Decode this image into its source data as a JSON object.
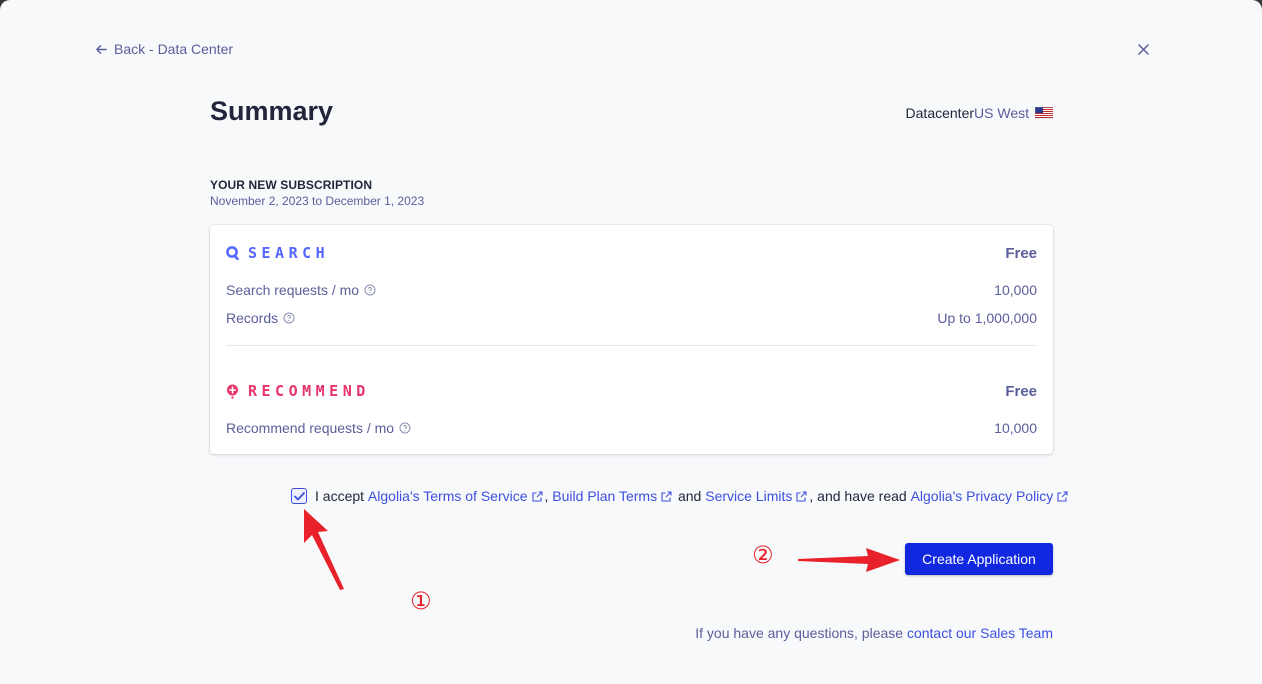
{
  "nav": {
    "back_label": "Back - Data Center"
  },
  "summary": {
    "title": "Summary",
    "datacenter_label": "Datacenter",
    "datacenter_region": "US West",
    "subscription_heading": "YOUR NEW SUBSCRIPTION",
    "subscription_dates": "November 2, 2023 to December 1, 2023"
  },
  "plan": {
    "search": {
      "name": "SEARCH",
      "price": "Free",
      "rows": [
        {
          "label": "Search requests / mo",
          "value": "10,000"
        },
        {
          "label": "Records",
          "value": "Up to 1,000,000"
        }
      ]
    },
    "recommend": {
      "name": "RECOMMEND",
      "price": "Free",
      "rows": [
        {
          "label": "Recommend requests / mo",
          "value": "10,000"
        }
      ]
    }
  },
  "terms": {
    "checked": true,
    "prefix": "I accept ",
    "tos_link": "Algolia's Terms of Service",
    "sep1": ", ",
    "build_link": "Build Plan Terms",
    "and": " and ",
    "limits_link": "Service Limits",
    "have_read": ", and have read ",
    "privacy_link": "Algolia's Privacy Policy"
  },
  "actions": {
    "create_label": "Create Application"
  },
  "footer": {
    "text": "If you have any questions, please ",
    "link": "contact our Sales Team"
  },
  "annotations": {
    "marker_1": "①",
    "marker_2": "②",
    "color": "#e8212a"
  },
  "colors": {
    "primary": "#1128e0",
    "search_brand": "#5468ff",
    "recommend_brand": "#e8346b",
    "muted_text": "#5a5e9a"
  }
}
